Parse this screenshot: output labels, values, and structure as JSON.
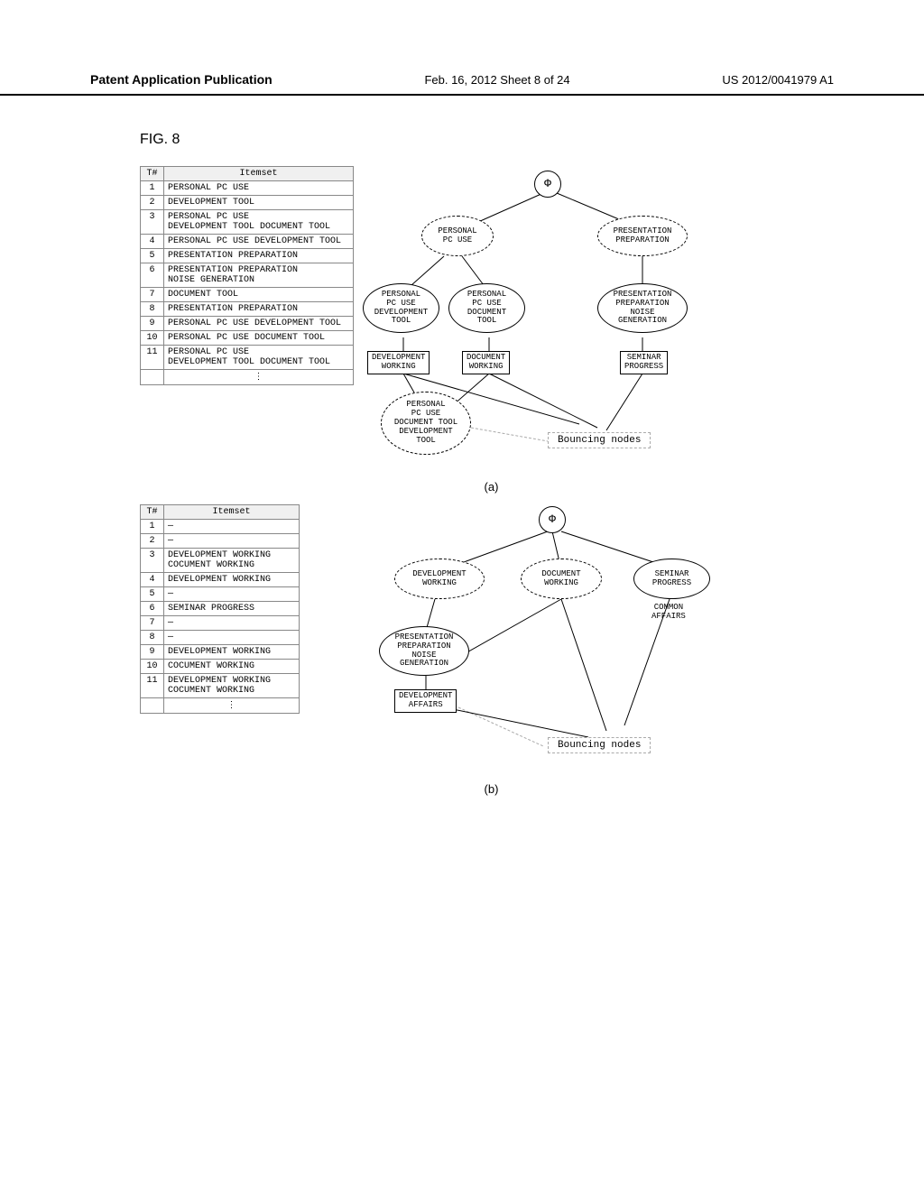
{
  "header": {
    "left": "Patent Application Publication",
    "mid": "Feb. 16, 2012   Sheet 8 of 24",
    "right": "US 2012/0041979 A1"
  },
  "figure_label": "FIG. 8",
  "panel_a_label": "(a)",
  "panel_b_label": "(b)",
  "table_a": {
    "head_tn": "T#",
    "head_itemset": "Itemset",
    "rows": [
      {
        "tn": "1",
        "items": "PERSONAL PC USE"
      },
      {
        "tn": "2",
        "items": "DEVELOPMENT TOOL"
      },
      {
        "tn": "3",
        "items": "PERSONAL PC USE\nDEVELOPMENT TOOL DOCUMENT TOOL"
      },
      {
        "tn": "4",
        "items": "PERSONAL PC USE DEVELOPMENT TOOL"
      },
      {
        "tn": "5",
        "items": "PRESENTATION PREPARATION"
      },
      {
        "tn": "6",
        "items": "PRESENTATION PREPARATION\nNOISE GENERATION"
      },
      {
        "tn": "7",
        "items": "DOCUMENT TOOL"
      },
      {
        "tn": "8",
        "items": "PRESENTATION PREPARATION"
      },
      {
        "tn": "9",
        "items": "PERSONAL PC USE DEVELOPMENT TOOL"
      },
      {
        "tn": "10",
        "items": "PERSONAL PC USE DOCUMENT TOOL"
      },
      {
        "tn": "11",
        "items": "PERSONAL PC USE\nDEVELOPMENT TOOL DOCUMENT TOOL"
      }
    ],
    "ellipsis": "⋮"
  },
  "table_b": {
    "head_tn": "T#",
    "head_itemset": "Itemset",
    "rows": [
      {
        "tn": "1",
        "items": "—"
      },
      {
        "tn": "2",
        "items": "—"
      },
      {
        "tn": "3",
        "items": "DEVELOPMENT WORKING\nCOCUMENT WORKING"
      },
      {
        "tn": "4",
        "items": "DEVELOPMENT WORKING"
      },
      {
        "tn": "5",
        "items": "—"
      },
      {
        "tn": "6",
        "items": "SEMINAR PROGRESS"
      },
      {
        "tn": "7",
        "items": "—"
      },
      {
        "tn": "8",
        "items": "—"
      },
      {
        "tn": "9",
        "items": "DEVELOPMENT WORKING"
      },
      {
        "tn": "10",
        "items": "COCUMENT WORKING"
      },
      {
        "tn": "11",
        "items": "DEVELOPMENT WORKING\nCOCUMENT WORKING"
      }
    ],
    "ellipsis": "⋮"
  },
  "diagram_a": {
    "root": "Φ",
    "n1": "PERSONAL\nPC USE",
    "n2": "PRESENTATION\nPREPARATION",
    "n3": "PERSONAL\nPC USE\nDEVELOPMENT\nTOOL",
    "n4": "PERSONAL\nPC USE\nDOCUMENT\nTOOL",
    "n5": "PRESENTATION\nPREPARATION\nNOISE\nGENERATION",
    "r1": "DEVELOPMENT\nWORKING",
    "r2": "DOCUMENT\nWORKING",
    "r3": "SEMINAR\nPROGRESS",
    "n6": "PERSONAL\nPC USE\nDOCUMENT TOOL\nDEVELOPMENT\nTOOL",
    "bouncing": "Bouncing nodes"
  },
  "diagram_b": {
    "root": "Φ",
    "n1": "DEVELOPMENT\nWORKING",
    "n2": "DOCUMENT\nWORKING",
    "n3": "SEMINAR\nPROGRESS",
    "side": "COMMON\nAFFAIRS",
    "n4": "PRESENTATION\nPREPARATION\nNOISE\nGENERATION",
    "r1": "DEVELOPMENT\nAFFAIRS",
    "bouncing": "Bouncing nodes"
  }
}
